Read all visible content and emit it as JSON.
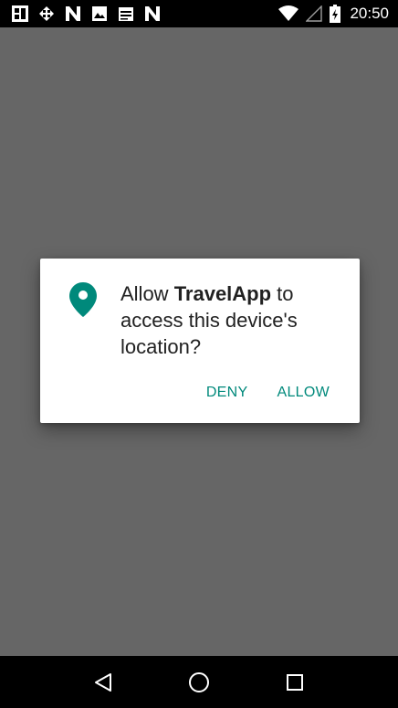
{
  "status_bar": {
    "time": "20:50",
    "left_icons": [
      "app-notification-icon",
      "sync-icon",
      "n-icon",
      "image-icon",
      "calendar-icon",
      "n-icon"
    ],
    "right_icons": [
      "wifi-icon",
      "signal-icon",
      "battery-charging-icon"
    ]
  },
  "dialog": {
    "message_prefix": "Allow ",
    "app_name": "TravelApp",
    "message_suffix": " to access this device's location?",
    "deny_label": "DENY",
    "allow_label": "ALLOW",
    "icon": "location-pin-icon"
  },
  "nav_bar": {
    "buttons": [
      "back-icon",
      "home-icon",
      "recents-icon"
    ]
  },
  "colors": {
    "accent": "#00897b",
    "scrim": "#666666",
    "bars": "#000000"
  }
}
